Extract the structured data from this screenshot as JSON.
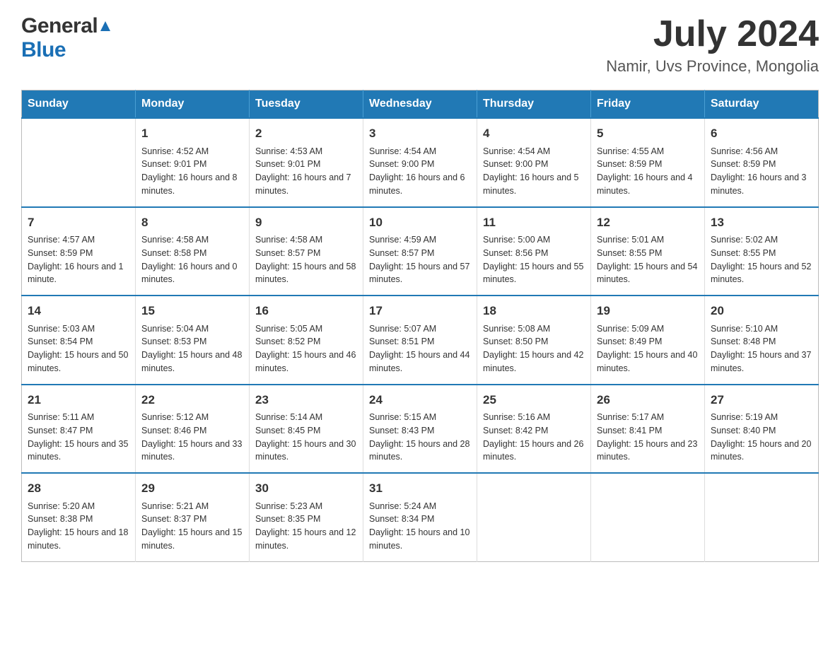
{
  "header": {
    "logo_general": "General",
    "logo_blue": "Blue",
    "title": "July 2024",
    "location": "Namir, Uvs Province, Mongolia"
  },
  "days_of_week": [
    "Sunday",
    "Monday",
    "Tuesday",
    "Wednesday",
    "Thursday",
    "Friday",
    "Saturday"
  ],
  "weeks": [
    [
      {
        "day": "",
        "sunrise": "",
        "sunset": "",
        "daylight": ""
      },
      {
        "day": "1",
        "sunrise": "Sunrise: 4:52 AM",
        "sunset": "Sunset: 9:01 PM",
        "daylight": "Daylight: 16 hours and 8 minutes."
      },
      {
        "day": "2",
        "sunrise": "Sunrise: 4:53 AM",
        "sunset": "Sunset: 9:01 PM",
        "daylight": "Daylight: 16 hours and 7 minutes."
      },
      {
        "day": "3",
        "sunrise": "Sunrise: 4:54 AM",
        "sunset": "Sunset: 9:00 PM",
        "daylight": "Daylight: 16 hours and 6 minutes."
      },
      {
        "day": "4",
        "sunrise": "Sunrise: 4:54 AM",
        "sunset": "Sunset: 9:00 PM",
        "daylight": "Daylight: 16 hours and 5 minutes."
      },
      {
        "day": "5",
        "sunrise": "Sunrise: 4:55 AM",
        "sunset": "Sunset: 8:59 PM",
        "daylight": "Daylight: 16 hours and 4 minutes."
      },
      {
        "day": "6",
        "sunrise": "Sunrise: 4:56 AM",
        "sunset": "Sunset: 8:59 PM",
        "daylight": "Daylight: 16 hours and 3 minutes."
      }
    ],
    [
      {
        "day": "7",
        "sunrise": "Sunrise: 4:57 AM",
        "sunset": "Sunset: 8:59 PM",
        "daylight": "Daylight: 16 hours and 1 minute."
      },
      {
        "day": "8",
        "sunrise": "Sunrise: 4:58 AM",
        "sunset": "Sunset: 8:58 PM",
        "daylight": "Daylight: 16 hours and 0 minutes."
      },
      {
        "day": "9",
        "sunrise": "Sunrise: 4:58 AM",
        "sunset": "Sunset: 8:57 PM",
        "daylight": "Daylight: 15 hours and 58 minutes."
      },
      {
        "day": "10",
        "sunrise": "Sunrise: 4:59 AM",
        "sunset": "Sunset: 8:57 PM",
        "daylight": "Daylight: 15 hours and 57 minutes."
      },
      {
        "day": "11",
        "sunrise": "Sunrise: 5:00 AM",
        "sunset": "Sunset: 8:56 PM",
        "daylight": "Daylight: 15 hours and 55 minutes."
      },
      {
        "day": "12",
        "sunrise": "Sunrise: 5:01 AM",
        "sunset": "Sunset: 8:55 PM",
        "daylight": "Daylight: 15 hours and 54 minutes."
      },
      {
        "day": "13",
        "sunrise": "Sunrise: 5:02 AM",
        "sunset": "Sunset: 8:55 PM",
        "daylight": "Daylight: 15 hours and 52 minutes."
      }
    ],
    [
      {
        "day": "14",
        "sunrise": "Sunrise: 5:03 AM",
        "sunset": "Sunset: 8:54 PM",
        "daylight": "Daylight: 15 hours and 50 minutes."
      },
      {
        "day": "15",
        "sunrise": "Sunrise: 5:04 AM",
        "sunset": "Sunset: 8:53 PM",
        "daylight": "Daylight: 15 hours and 48 minutes."
      },
      {
        "day": "16",
        "sunrise": "Sunrise: 5:05 AM",
        "sunset": "Sunset: 8:52 PM",
        "daylight": "Daylight: 15 hours and 46 minutes."
      },
      {
        "day": "17",
        "sunrise": "Sunrise: 5:07 AM",
        "sunset": "Sunset: 8:51 PM",
        "daylight": "Daylight: 15 hours and 44 minutes."
      },
      {
        "day": "18",
        "sunrise": "Sunrise: 5:08 AM",
        "sunset": "Sunset: 8:50 PM",
        "daylight": "Daylight: 15 hours and 42 minutes."
      },
      {
        "day": "19",
        "sunrise": "Sunrise: 5:09 AM",
        "sunset": "Sunset: 8:49 PM",
        "daylight": "Daylight: 15 hours and 40 minutes."
      },
      {
        "day": "20",
        "sunrise": "Sunrise: 5:10 AM",
        "sunset": "Sunset: 8:48 PM",
        "daylight": "Daylight: 15 hours and 37 minutes."
      }
    ],
    [
      {
        "day": "21",
        "sunrise": "Sunrise: 5:11 AM",
        "sunset": "Sunset: 8:47 PM",
        "daylight": "Daylight: 15 hours and 35 minutes."
      },
      {
        "day": "22",
        "sunrise": "Sunrise: 5:12 AM",
        "sunset": "Sunset: 8:46 PM",
        "daylight": "Daylight: 15 hours and 33 minutes."
      },
      {
        "day": "23",
        "sunrise": "Sunrise: 5:14 AM",
        "sunset": "Sunset: 8:45 PM",
        "daylight": "Daylight: 15 hours and 30 minutes."
      },
      {
        "day": "24",
        "sunrise": "Sunrise: 5:15 AM",
        "sunset": "Sunset: 8:43 PM",
        "daylight": "Daylight: 15 hours and 28 minutes."
      },
      {
        "day": "25",
        "sunrise": "Sunrise: 5:16 AM",
        "sunset": "Sunset: 8:42 PM",
        "daylight": "Daylight: 15 hours and 26 minutes."
      },
      {
        "day": "26",
        "sunrise": "Sunrise: 5:17 AM",
        "sunset": "Sunset: 8:41 PM",
        "daylight": "Daylight: 15 hours and 23 minutes."
      },
      {
        "day": "27",
        "sunrise": "Sunrise: 5:19 AM",
        "sunset": "Sunset: 8:40 PM",
        "daylight": "Daylight: 15 hours and 20 minutes."
      }
    ],
    [
      {
        "day": "28",
        "sunrise": "Sunrise: 5:20 AM",
        "sunset": "Sunset: 8:38 PM",
        "daylight": "Daylight: 15 hours and 18 minutes."
      },
      {
        "day": "29",
        "sunrise": "Sunrise: 5:21 AM",
        "sunset": "Sunset: 8:37 PM",
        "daylight": "Daylight: 15 hours and 15 minutes."
      },
      {
        "day": "30",
        "sunrise": "Sunrise: 5:23 AM",
        "sunset": "Sunset: 8:35 PM",
        "daylight": "Daylight: 15 hours and 12 minutes."
      },
      {
        "day": "31",
        "sunrise": "Sunrise: 5:24 AM",
        "sunset": "Sunset: 8:34 PM",
        "daylight": "Daylight: 15 hours and 10 minutes."
      },
      {
        "day": "",
        "sunrise": "",
        "sunset": "",
        "daylight": ""
      },
      {
        "day": "",
        "sunrise": "",
        "sunset": "",
        "daylight": ""
      },
      {
        "day": "",
        "sunrise": "",
        "sunset": "",
        "daylight": ""
      }
    ]
  ]
}
